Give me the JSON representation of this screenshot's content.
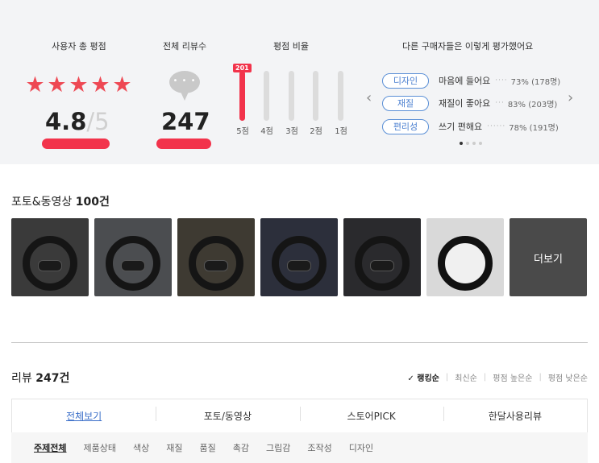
{
  "summary": {
    "rating_title": "사용자 총 평점",
    "reviews_title": "전체 리뷰수",
    "ratio_title": "평점 비율",
    "others_title": "다른 구매자들은 이렇게 평가했어요",
    "star_count": 5,
    "score": "4.8",
    "score_max": "/5",
    "review_count": "247",
    "bubble_dots": "• • •",
    "bars": [
      {
        "label": "5점",
        "fraction": 1.0,
        "badge": "201"
      },
      {
        "label": "4점",
        "fraction": 0.0
      },
      {
        "label": "3점",
        "fraction": 0.0
      },
      {
        "label": "2점",
        "fraction": 0.0
      },
      {
        "label": "1점",
        "fraction": 0.0
      }
    ],
    "evaluations": [
      {
        "tag": "디자인",
        "text": "마음에 들어요",
        "dots": "····",
        "pct": "73% (178명)"
      },
      {
        "tag": "재질",
        "text": "재질이 좋아요",
        "dots": "···",
        "pct": "83% (203명)"
      },
      {
        "tag": "편리성",
        "text": "쓰기 편해요",
        "dots": "······",
        "pct": "78% (191명)"
      }
    ],
    "prev_icon": "chevron-left-icon",
    "next_icon": "chevron-right-icon"
  },
  "photos": {
    "title_prefix": "포토&동영상",
    "title_count": "100건",
    "more_label": "더보기",
    "count": 7
  },
  "reviews": {
    "title_prefix": "리뷰",
    "title_count": "247건",
    "sorts": [
      "✓ 랭킹순",
      "최신순",
      "평점 높은순",
      "평점 낮은순"
    ],
    "tabs": [
      "전체보기",
      "포토/동영상",
      "스토어PICK",
      "한달사용리뷰"
    ],
    "subtabs": [
      "주제전체",
      "제품상태",
      "색상",
      "재질",
      "품질",
      "촉감",
      "그립감",
      "조작성",
      "디자인"
    ]
  },
  "colors": {
    "accent_red": "#f2334b",
    "star_red": "#ee4853",
    "tag_blue": "#4a7fd0",
    "band_bg": "#f3f4f6"
  }
}
